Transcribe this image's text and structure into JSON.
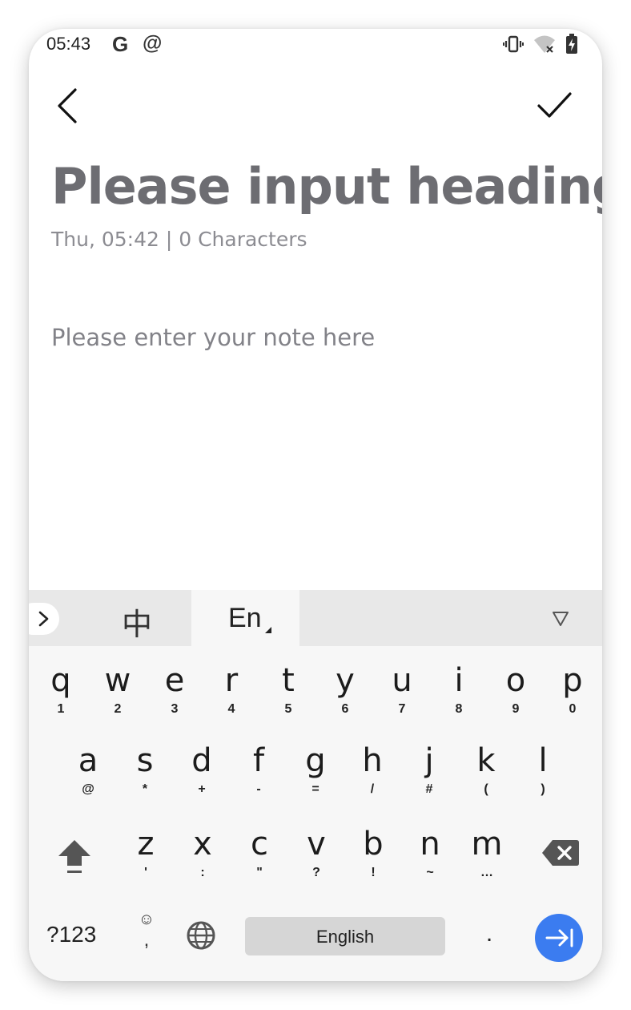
{
  "status_bar": {
    "time": "05:43",
    "left_icons": [
      "google-g-icon",
      "at-sign-icon"
    ],
    "right_icons": [
      "vibrate-icon",
      "wifi-off-icon",
      "battery-charging-icon"
    ],
    "g_glyph": "G",
    "at_glyph": "@"
  },
  "toolbar": {
    "back_icon": "chevron-left-icon",
    "confirm_icon": "checkmark-icon"
  },
  "editor": {
    "heading_placeholder": "Please input heading",
    "meta": "Thu, 05:42 | 0 Characters",
    "body_placeholder": "Please enter your note here"
  },
  "keyboard": {
    "tab_chinese": "中",
    "tab_english": "En",
    "rows": [
      [
        {
          "ch": "q",
          "hint": "1"
        },
        {
          "ch": "w",
          "hint": "2"
        },
        {
          "ch": "e",
          "hint": "3"
        },
        {
          "ch": "r",
          "hint": "4"
        },
        {
          "ch": "t",
          "hint": "5"
        },
        {
          "ch": "y",
          "hint": "6"
        },
        {
          "ch": "u",
          "hint": "7"
        },
        {
          "ch": "i",
          "hint": "8"
        },
        {
          "ch": "o",
          "hint": "9"
        },
        {
          "ch": "p",
          "hint": "0"
        }
      ],
      [
        {
          "ch": "a",
          "hint": "@"
        },
        {
          "ch": "s",
          "hint": "*"
        },
        {
          "ch": "d",
          "hint": "+"
        },
        {
          "ch": "f",
          "hint": "-"
        },
        {
          "ch": "g",
          "hint": "="
        },
        {
          "ch": "h",
          "hint": "/"
        },
        {
          "ch": "j",
          "hint": "#"
        },
        {
          "ch": "k",
          "hint": "("
        },
        {
          "ch": "l",
          "hint": ")"
        }
      ],
      [
        {
          "ch": "z",
          "hint": "'"
        },
        {
          "ch": "x",
          "hint": ":"
        },
        {
          "ch": "c",
          "hint": "\""
        },
        {
          "ch": "v",
          "hint": "?"
        },
        {
          "ch": "b",
          "hint": "!"
        },
        {
          "ch": "n",
          "hint": "~"
        },
        {
          "ch": "m",
          "hint": "…"
        }
      ]
    ],
    "numbers_label": "?123",
    "emoji_glyph": "☺",
    "comma_label": ",",
    "space_label": "English",
    "period_label": ".",
    "accent_color": "#3b7cf0"
  }
}
